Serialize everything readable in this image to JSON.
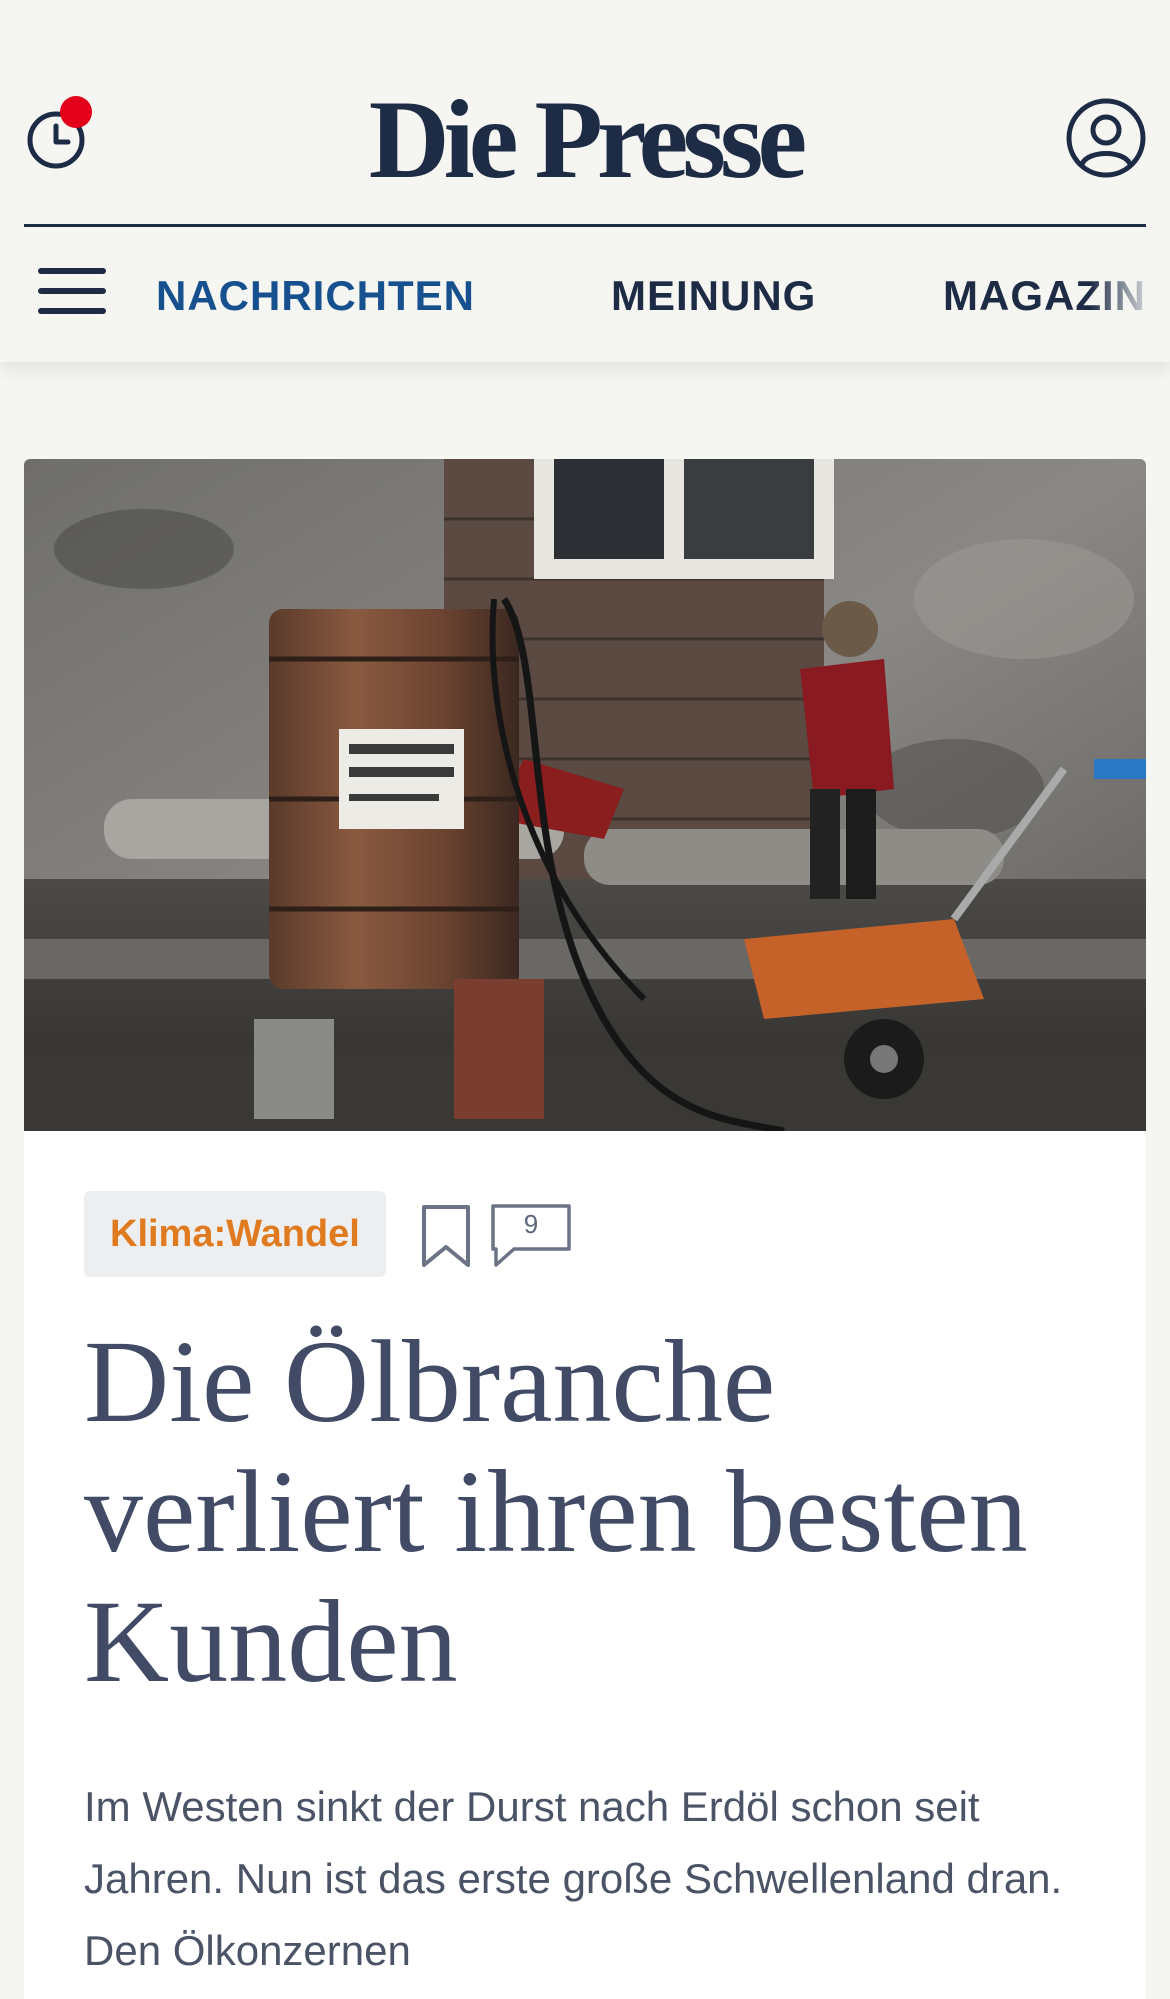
{
  "header": {
    "logo": "Die Presse",
    "history_icon": "clock-icon",
    "profile_icon": "user-circle-icon",
    "menu_icon": "hamburger-menu-icon",
    "notification_color": "#e2001a",
    "brand_color": "#1d2b45"
  },
  "nav": {
    "items": [
      {
        "label": "NACHRICHTEN",
        "active": true
      },
      {
        "label": "MEINUNG",
        "active": false
      },
      {
        "label": "MAGAZIN",
        "active": false
      }
    ],
    "active_color": "#16508e"
  },
  "article": {
    "image_icon": "photo-oil-barrel-child",
    "tag": "Klima:Wandel",
    "tag_color": "#e07a1f",
    "bookmark_icon": "bookmark-icon",
    "comment_icon": "comment-bubble-icon",
    "comment_count": "9",
    "headline": "Die Ölbranche verliert ihren besten Kunden",
    "lead": "Im Westen sinkt der Durst nach Erdöl schon seit Jahren. Nun ist das erste große Schwellenland dran. Den Ölkonzernen"
  }
}
